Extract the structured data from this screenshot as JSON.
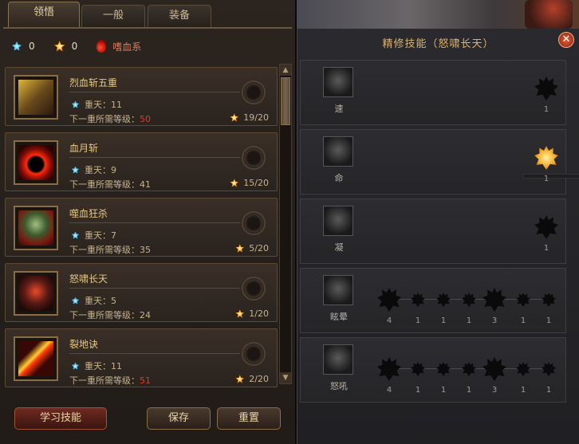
{
  "tabs": [
    {
      "label": "领悟",
      "active": true
    },
    {
      "label": "一般",
      "active": false
    },
    {
      "label": "装备",
      "active": false
    }
  ],
  "stats": {
    "blue_points": "0",
    "orange_points": "0",
    "school": "嗜血系"
  },
  "skills": [
    {
      "name": "烈血斩五重",
      "level_text": "重天：11",
      "req_label": "下一重所需等级：",
      "req_level": "50",
      "req_red": true,
      "progress": "19/20",
      "icon": "blade-skill-icon"
    },
    {
      "name": "血月斩",
      "level_text": "重天：9",
      "req_label": "下一重所需等级：",
      "req_level": "41",
      "req_red": false,
      "progress": "15/20",
      "icon": "blood-moon-icon"
    },
    {
      "name": "噬血狂杀",
      "level_text": "重天：7",
      "req_label": "下一重所需等级：",
      "req_level": "35",
      "req_red": false,
      "progress": "5/20",
      "icon": "skull-icon"
    },
    {
      "name": "怒啸长天",
      "level_text": "重天：5",
      "req_label": "下一重所需等级：",
      "req_level": "24",
      "req_red": false,
      "progress": "1/20",
      "icon": "demon-roar-icon"
    },
    {
      "name": "裂地诀",
      "level_text": "重天：11",
      "req_label": "下一重所需等级：",
      "req_level": "51",
      "req_red": true,
      "progress": "2/20",
      "icon": "ground-split-icon"
    }
  ],
  "buttons": {
    "learn": "学习技能",
    "save": "保存",
    "reset": "重置"
  },
  "refine": {
    "title": "精修技能（怒啸长天）",
    "rows": [
      {
        "label": "速",
        "nodes": [
          {
            "count": "1",
            "lit": false,
            "big": true
          }
        ]
      },
      {
        "label": "命",
        "nodes": [
          {
            "count": "1",
            "lit": true,
            "big": true
          }
        ]
      },
      {
        "label": "凝",
        "nodes": [
          {
            "count": "1",
            "lit": false,
            "big": true
          }
        ]
      },
      {
        "label": "眩晕",
        "nodes": [
          {
            "count": "4",
            "lit": false,
            "big": true
          },
          {
            "count": "1",
            "lit": false,
            "big": false
          },
          {
            "count": "1",
            "lit": false,
            "big": false
          },
          {
            "count": "1",
            "lit": false,
            "big": false
          },
          {
            "count": "3",
            "lit": false,
            "big": true
          },
          {
            "count": "1",
            "lit": false,
            "big": false
          },
          {
            "count": "1",
            "lit": false,
            "big": false
          }
        ]
      },
      {
        "label": "怒吼",
        "nodes": [
          {
            "count": "4",
            "lit": false,
            "big": true
          },
          {
            "count": "1",
            "lit": false,
            "big": false
          },
          {
            "count": "1",
            "lit": false,
            "big": false
          },
          {
            "count": "1",
            "lit": false,
            "big": false
          },
          {
            "count": "3",
            "lit": false,
            "big": true
          },
          {
            "count": "1",
            "lit": false,
            "big": false
          },
          {
            "count": "1",
            "lit": false,
            "big": false
          }
        ]
      }
    ]
  },
  "colors": {
    "accent_gold": "#e5c883",
    "required_level_red": "#d73d2a",
    "title_gold": "#dcb36a"
  }
}
